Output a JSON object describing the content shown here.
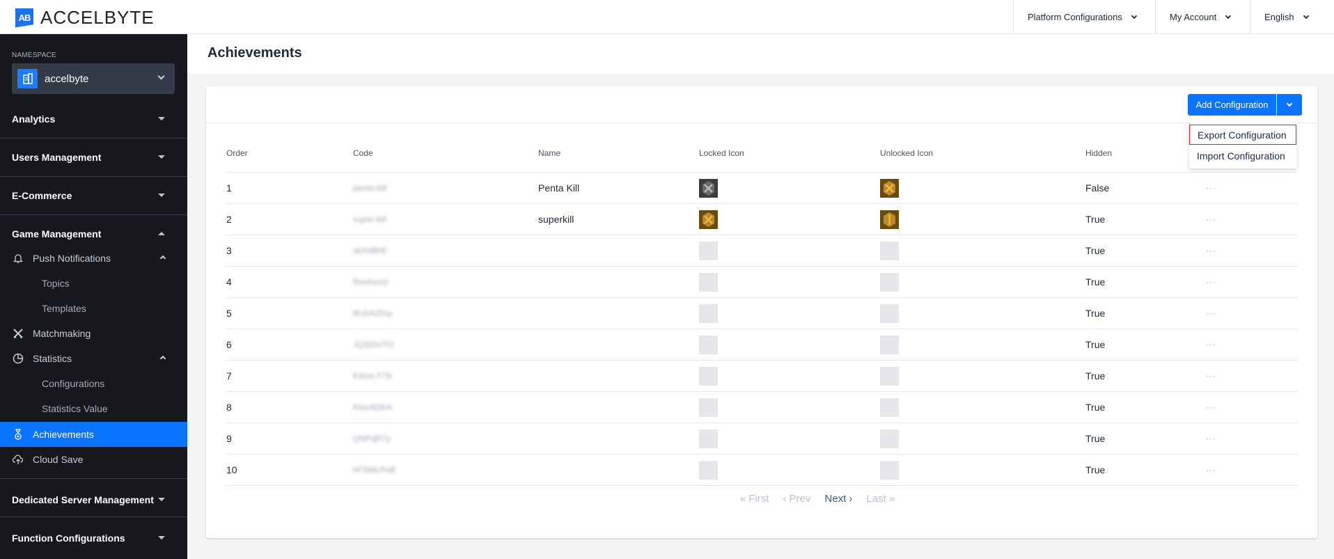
{
  "header": {
    "brand": "ACCELBYTE",
    "brand_mark": "AB",
    "nav": [
      {
        "label": "Platform Configurations"
      },
      {
        "label": "My Account"
      },
      {
        "label": "English"
      }
    ]
  },
  "sidebar": {
    "namespace_label": "NAMESPACE",
    "namespace_value": "accelbyte",
    "sections": {
      "analytics": "Analytics",
      "users": "Users Management",
      "ecommerce": "E-Commerce",
      "game": "Game Management",
      "dsm": "Dedicated Server Management",
      "functions": "Function Configurations"
    },
    "game_items": {
      "push": "Push Notifications",
      "topics": "Topics",
      "templates": "Templates",
      "matchmaking": "Matchmaking",
      "statistics": "Statistics",
      "stat_configs": "Configurations",
      "stat_values": "Statistics Value",
      "achievements": "Achievements",
      "cloudsave": "Cloud Save"
    },
    "active": "Achievements"
  },
  "page": {
    "title": "Achievements"
  },
  "toolbar": {
    "add_label": "Add Configuration",
    "menu": [
      "Export Configuration",
      "Import Configuration"
    ],
    "highlighted": "Export Configuration"
  },
  "table": {
    "headers": [
      "Order",
      "Code",
      "Name",
      "Locked Icon",
      "Unlocked Icon",
      "Hidden"
    ],
    "more_label": "···",
    "rows": [
      {
        "order": "1",
        "code": "penta-kill",
        "name": "Penta Kill",
        "locked": "gray",
        "unlocked": "gold",
        "hidden": "False"
      },
      {
        "order": "2",
        "code": "super-kill",
        "name": "superkill",
        "locked": "gold",
        "unlocked": "gold",
        "hidden": "True"
      },
      {
        "order": "3",
        "code": "skX4BhE",
        "name": "",
        "locked": "empty",
        "unlocked": "empty",
        "hidden": "True"
      },
      {
        "order": "4",
        "code": "Reefsos2",
        "name": "",
        "locked": "empty",
        "unlocked": "empty",
        "hidden": "True"
      },
      {
        "order": "5",
        "code": "BcGA20sy",
        "name": "",
        "locked": "empty",
        "unlocked": "empty",
        "hidden": "True"
      },
      {
        "order": "6",
        "code": "JQ3IDUTO",
        "name": "",
        "locked": "empty",
        "unlocked": "empty",
        "hidden": "True"
      },
      {
        "order": "7",
        "code": "K4mo F79",
        "name": "",
        "locked": "empty",
        "unlocked": "empty",
        "hidden": "True"
      },
      {
        "order": "8",
        "code": "KlseADKA",
        "name": "",
        "locked": "empty",
        "unlocked": "empty",
        "hidden": "True"
      },
      {
        "order": "9",
        "code": "QNPqR7y",
        "name": "",
        "locked": "empty",
        "unlocked": "empty",
        "hidden": "True"
      },
      {
        "order": "10",
        "code": "hFSMLPeB",
        "name": "",
        "locked": "empty",
        "unlocked": "empty",
        "hidden": "True"
      }
    ]
  },
  "pagination": {
    "first": "« First",
    "prev": "‹ Prev",
    "next": "Next ›",
    "last": "Last »"
  },
  "colors": {
    "accent": "#0a74ff",
    "sidebar_bg": "#16181d",
    "highlight_border": "#e02424"
  }
}
